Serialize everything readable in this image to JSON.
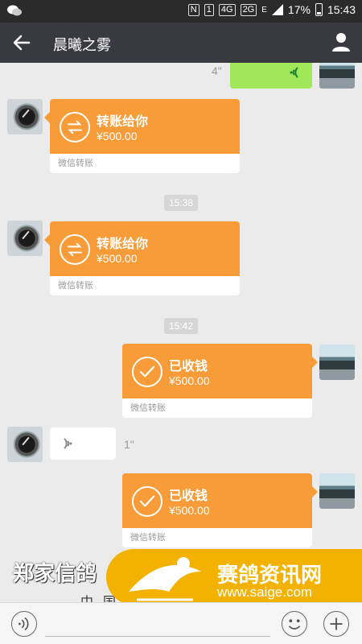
{
  "status_bar": {
    "network_1": "4G",
    "network_2": "2G",
    "network_3": "E",
    "battery": "17%",
    "time": "15:43"
  },
  "header": {
    "title": "晨曦之雾",
    "back_icon": "arrow-left-icon",
    "profile_icon": "person-icon"
  },
  "messages": [
    {
      "type": "voice",
      "side": "sent",
      "duration": "4\""
    },
    {
      "type": "transfer",
      "side": "received",
      "title": "转账给你",
      "amount": "¥500.00",
      "footer": "微信转账"
    },
    {
      "type": "time",
      "text": "15:38"
    },
    {
      "type": "transfer",
      "side": "received",
      "title": "转账给你",
      "amount": "¥500.00",
      "footer": "微信转账"
    },
    {
      "type": "time",
      "text": "15:42"
    },
    {
      "type": "transfer",
      "side": "sent",
      "title": "已收钱",
      "amount": "¥500.00",
      "footer": "微信转账"
    },
    {
      "type": "voice",
      "side": "received",
      "duration": "1\""
    },
    {
      "type": "transfer",
      "side": "sent",
      "title": "已收钱",
      "amount": "¥500.00",
      "footer": "微信转账"
    }
  ],
  "input_bar": {
    "value": "",
    "placeholder": ""
  },
  "watermark": {
    "left_text": "郑家信鸽",
    "left_sub": "中国",
    "brand": "赛鸽资讯网",
    "url": "www.saige.com"
  },
  "colors": {
    "transfer_orange": "#f79c38",
    "voice_green": "#a0e75a",
    "navbar": "#393a3f",
    "chat_bg": "#ebebeb"
  }
}
